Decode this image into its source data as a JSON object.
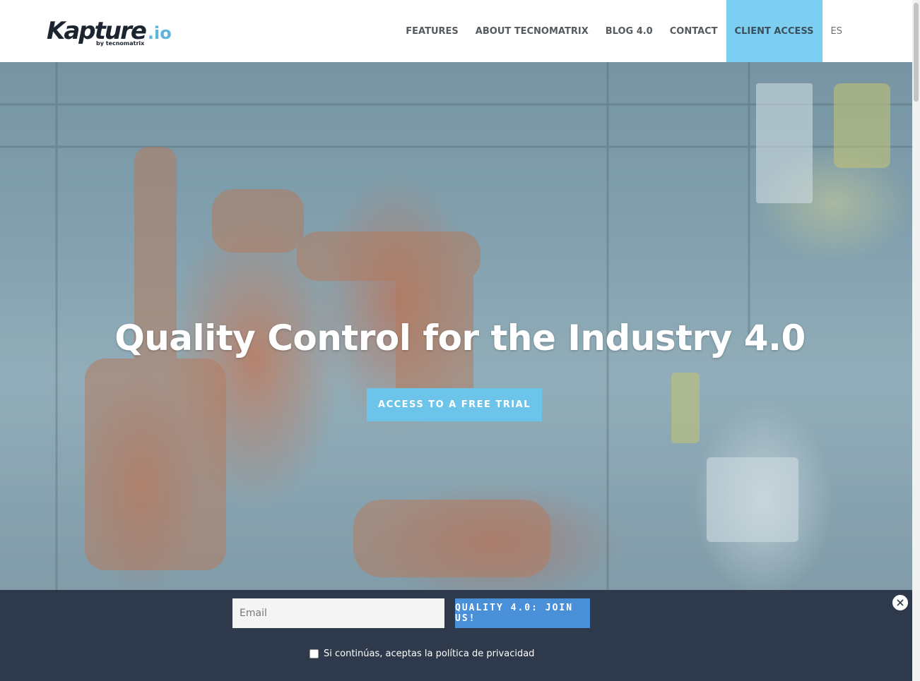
{
  "header": {
    "logo": {
      "main": "Kapture",
      "suffix": ".io",
      "tagline": "by tecnomatrix"
    },
    "nav": [
      {
        "label": "FEATURES"
      },
      {
        "label": "ABOUT TECNOMATRIX"
      },
      {
        "label": "BLOG 4.0"
      },
      {
        "label": "CONTACT"
      },
      {
        "label": "CLIENT ACCESS"
      },
      {
        "label": "ES"
      }
    ]
  },
  "hero": {
    "title": "Quality Control for the Industry 4.0",
    "cta_label": "ACCESS TO A FREE TRIAL"
  },
  "optin": {
    "email_placeholder": "Email",
    "join_label": "QUALITY 4.0: JOIN US!",
    "consent_text": "Si continúas, aceptas la política de privacidad",
    "consent_checked": false
  },
  "colors": {
    "accent": "#7ccff0",
    "cta": "#6cc4ea",
    "optin_bg": "#2e3a4c",
    "join_button": "#4a90d9"
  }
}
